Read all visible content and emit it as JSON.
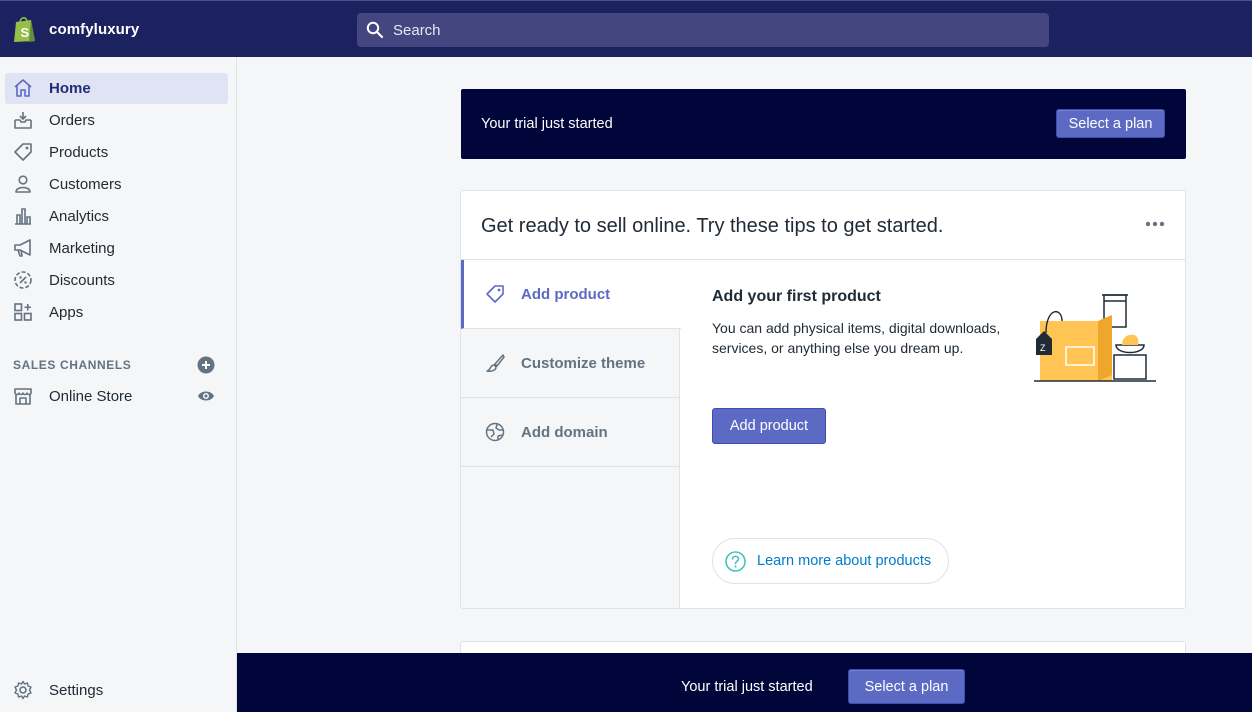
{
  "store": {
    "name": "comfyluxury"
  },
  "search": {
    "placeholder": "Search"
  },
  "sidebar": {
    "items": [
      {
        "label": "Home",
        "icon": "home-icon",
        "active": true
      },
      {
        "label": "Orders",
        "icon": "orders-icon"
      },
      {
        "label": "Products",
        "icon": "tag-icon"
      },
      {
        "label": "Customers",
        "icon": "person-icon"
      },
      {
        "label": "Analytics",
        "icon": "bar-chart-icon"
      },
      {
        "label": "Marketing",
        "icon": "megaphone-icon"
      },
      {
        "label": "Discounts",
        "icon": "discount-icon"
      },
      {
        "label": "Apps",
        "icon": "apps-icon"
      }
    ],
    "sales_channels_title": "SALES CHANNELS",
    "channels": [
      {
        "label": "Online Store",
        "icon": "store-icon"
      }
    ],
    "settings_label": "Settings"
  },
  "trial_banner": {
    "text": "Your trial just started",
    "button": "Select a plan"
  },
  "tips_card": {
    "title": "Get ready to sell online. Try these tips to get started.",
    "tips": [
      {
        "label": "Add product",
        "icon": "tag-icon",
        "active": true
      },
      {
        "label": "Customize theme",
        "icon": "brush-icon"
      },
      {
        "label": "Add domain",
        "icon": "globe-icon"
      }
    ],
    "content": {
      "heading": "Add your first product",
      "description": "You can add physical items, digital downloads, services, or anything else you dream up.",
      "button": "Add product",
      "learn_more": "Learn more about products"
    }
  },
  "bottom_banner": {
    "text": "Your trial just started",
    "button": "Select a plan"
  },
  "colors": {
    "topbar": "#1c2260",
    "banner": "#000639",
    "accent": "#5c6ac4",
    "link": "#007ace",
    "help": "#47c1bf",
    "illustration_yellow": "#ffc453"
  }
}
